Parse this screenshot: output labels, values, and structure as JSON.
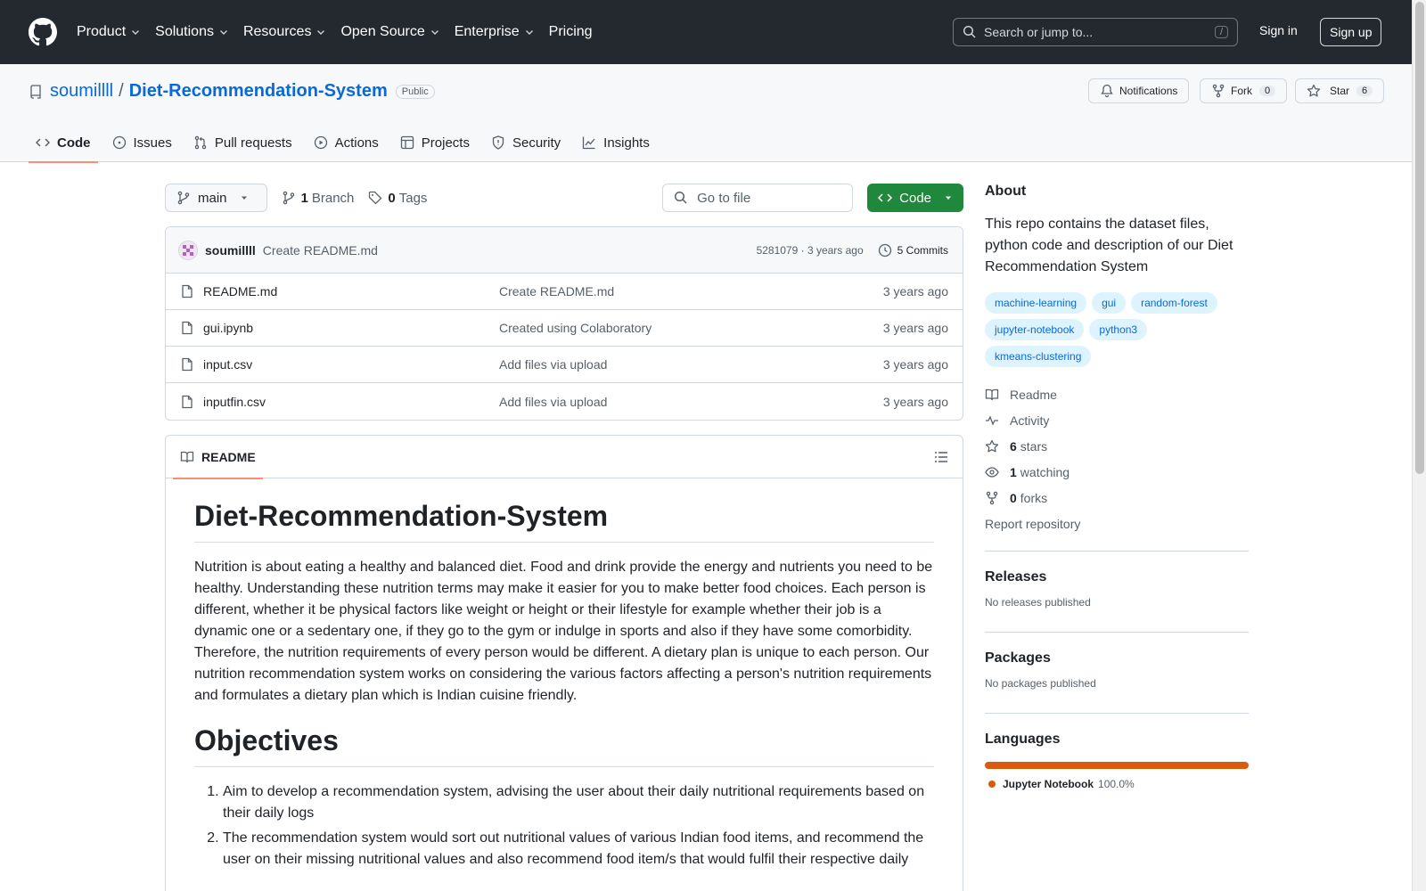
{
  "header": {
    "nav": [
      "Product",
      "Solutions",
      "Resources",
      "Open Source",
      "Enterprise",
      "Pricing"
    ],
    "search_placeholder": "Search or jump to...",
    "search_shortcut": "/",
    "signin": "Sign in",
    "signup": "Sign up"
  },
  "repo": {
    "owner": "soumillll",
    "separator": "/",
    "name": "Diet-Recommendation-System",
    "visibility": "Public",
    "notifications": "Notifications",
    "fork_label": "Fork",
    "fork_count": "0",
    "star_label": "Star",
    "star_count": "6"
  },
  "tabs": [
    "Code",
    "Issues",
    "Pull requests",
    "Actions",
    "Projects",
    "Security",
    "Insights"
  ],
  "toolbar": {
    "branch": "main",
    "branch_count": "1",
    "branch_label": "Branch",
    "tag_count": "0",
    "tag_label": "Tags",
    "gofile": "Go to file",
    "code": "Code"
  },
  "commit": {
    "user": "soumillll",
    "message": "Create README.md",
    "hash_time": "5281079 · 3 years ago",
    "commits": "5 Commits"
  },
  "files": [
    {
      "name": "README.md",
      "message": "Create README.md",
      "age": "3 years ago"
    },
    {
      "name": "gui.ipynb",
      "message": "Created using Colaboratory",
      "age": "3 years ago"
    },
    {
      "name": "input.csv",
      "message": "Add files via upload",
      "age": "3 years ago"
    },
    {
      "name": "inputfin.csv",
      "message": "Add files via upload",
      "age": "3 years ago"
    }
  ],
  "readme": {
    "tab": "README",
    "title": "Diet-Recommendation-System",
    "intro": "Nutrition is about eating a healthy and balanced diet. Food and drink provide the energy and nutrients you need to be healthy. Understanding these nutrition terms may make it easier for you to make better food choices. Each person is different, whether it be physical factors like weight or height or their lifestyle for example whether their job is a dynamic one or a sedentary one, if they go to the gym or indulge in sports and also if they have some comorbidity. Therefore, the nutrition requirements of every person would be different. A dietary plan is unique to each person. Our nutrition recommendation system works on considering the various factors affecting a person's nutrition requirements and formulates a dietary plan which is Indian cuisine friendly.",
    "objectives_title": "Objectives",
    "objectives": [
      "Aim to develop a recommendation system, advising the user about their daily nutritional requirements based on their daily logs",
      "The recommendation system would sort out nutritional values of various Indian food items, and recommend the user on their missing nutritional values and also recommend food item/s that would fulfil their respective daily"
    ]
  },
  "about": {
    "title": "About",
    "description": "This repo contains the dataset files, python code and description of our Diet Recommendation System",
    "topics": [
      "machine-learning",
      "gui",
      "random-forest",
      "jupyter-notebook",
      "python3",
      "kmeans-clustering"
    ],
    "readme": "Readme",
    "activity": "Activity",
    "stars_count": "6",
    "stars_label": "stars",
    "watching_count": "1",
    "watching_label": "watching",
    "forks_count": "0",
    "forks_label": "forks",
    "report": "Report repository"
  },
  "releases": {
    "title": "Releases",
    "note": "No releases published"
  },
  "packages": {
    "title": "Packages",
    "note": "No packages published"
  },
  "languages": {
    "title": "Languages",
    "items": [
      {
        "name": "Jupyter Notebook",
        "percent": "100.0%",
        "color": "#DA5B0B"
      }
    ]
  },
  "colors": {
    "header_bg": "#24292f",
    "link": "#0969da",
    "code_button": "#1f883d",
    "active_tab_underline": "#fd8c73"
  }
}
